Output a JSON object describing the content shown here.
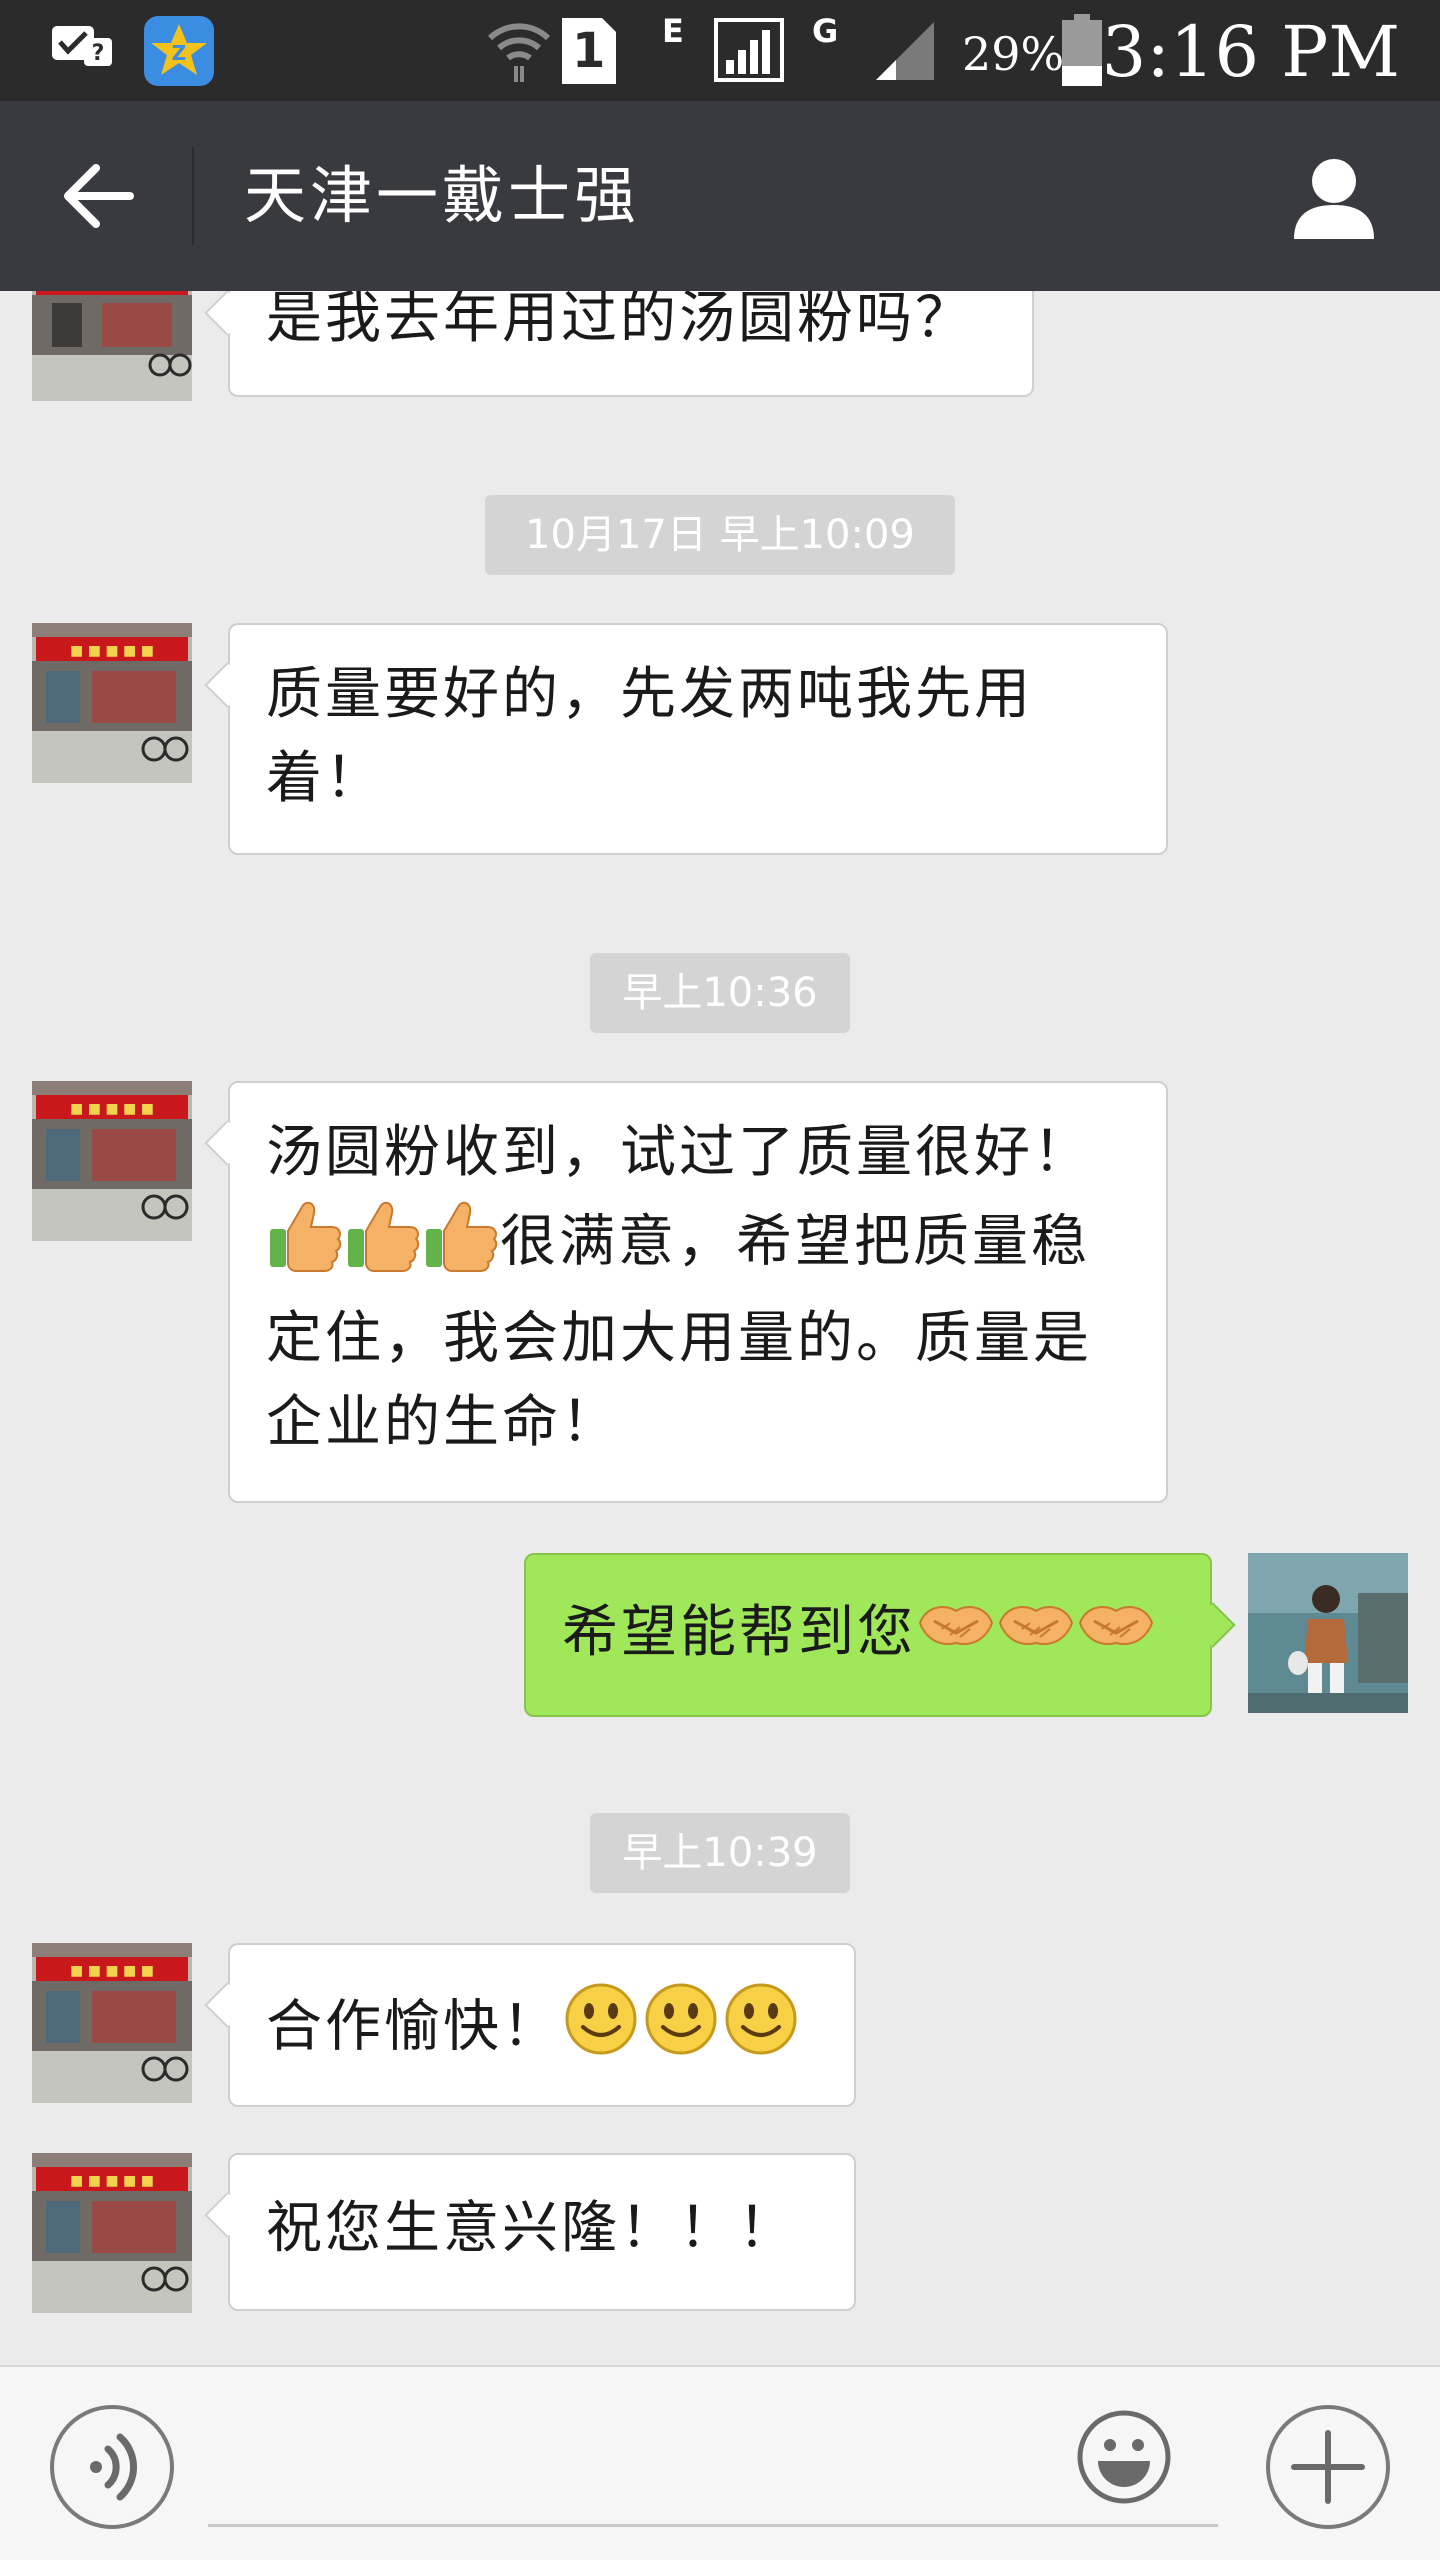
{
  "status_bar": {
    "time": "3:16 PM",
    "battery": "29%",
    "sim_badge": "1",
    "network_e": "E",
    "network_g": "G"
  },
  "header": {
    "title": "天津一戴士强"
  },
  "messages": [
    {
      "type": "incoming",
      "text": "是我去年用过的汤圆粉吗？"
    },
    {
      "type": "timestamp",
      "text": "10月17日  早上10:09"
    },
    {
      "type": "incoming",
      "line1": "质量要好的，先发两吨我先用",
      "line2": "着！"
    },
    {
      "type": "timestamp",
      "text": "早上10:36"
    },
    {
      "type": "incoming",
      "line1": "汤圆粉收到，试过了质量很好！",
      "line2_suffix": "很满意，希望把质量稳",
      "line3": "定住，我会加大用量的。质量是",
      "line4": "企业的生命！",
      "emoji": "thumbs-up"
    },
    {
      "type": "outgoing",
      "text": "希望能帮到您",
      "emoji": "handshake"
    },
    {
      "type": "timestamp",
      "text": "早上10:39"
    },
    {
      "type": "incoming",
      "text": "合作愉快！",
      "emoji": "smiley"
    },
    {
      "type": "incoming",
      "text": "祝您生意兴隆！！！"
    }
  ],
  "input": {
    "placeholder": ""
  },
  "colors": {
    "status_bar": "#2b2b2b",
    "title_bar": "#393a3f",
    "chat_bg": "#ebebeb",
    "outgoing_bubble": "#a0e75a",
    "incoming_bubble": "#ffffff"
  }
}
